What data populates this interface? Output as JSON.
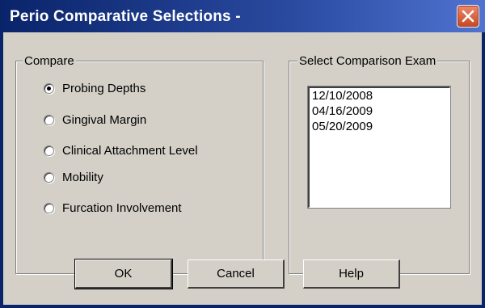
{
  "window": {
    "title": "Perio Comparative Selections -",
    "close_icon": "close-icon"
  },
  "compare": {
    "legend": "Compare",
    "options": [
      {
        "label": "Probing Depths",
        "checked": true
      },
      {
        "label": "Gingival Margin",
        "checked": false
      },
      {
        "label": "Clinical Attachment Level",
        "checked": false
      },
      {
        "label": "Mobility",
        "checked": false
      },
      {
        "label": "Furcation Involvement",
        "checked": false
      }
    ]
  },
  "exam": {
    "legend": "Select Comparison Exam",
    "dates": [
      "12/10/2008",
      "04/16/2009",
      "05/20/2009"
    ]
  },
  "buttons": {
    "ok": "OK",
    "cancel": "Cancel",
    "help": "Help"
  },
  "colors": {
    "titlebar": "#0a246a",
    "dialog_face": "#d4d0c8",
    "close_button": "#c9461f"
  }
}
